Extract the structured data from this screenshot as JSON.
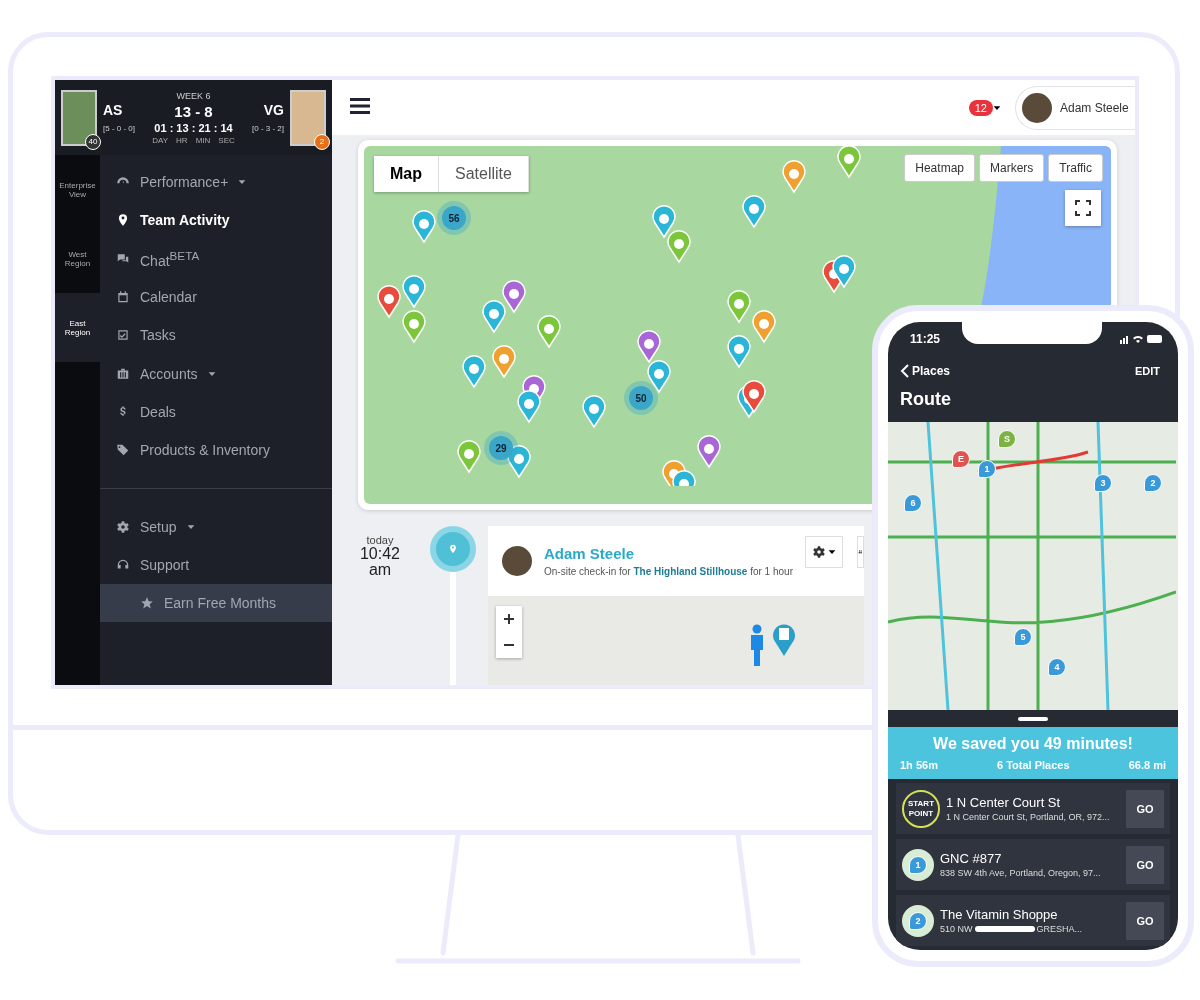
{
  "scoreboard": {
    "week": "WEEK 6",
    "home": {
      "initials": "AS",
      "record": "[5 - 0 - 0]",
      "badge": "40"
    },
    "away": {
      "initials": "VG",
      "record": "[0 - 3 - 2]",
      "badge": "2"
    },
    "score": "13 - 8",
    "countdown": "01 : 13 : 21 : 14",
    "units": [
      "DAY",
      "HR",
      "MIN",
      "SEC"
    ]
  },
  "regions": [
    {
      "label": "Enterprise View",
      "selected": false
    },
    {
      "label": "West Region",
      "selected": false
    },
    {
      "label": "East Region",
      "selected": true
    }
  ],
  "nav": [
    {
      "label": "Performance+",
      "kind": "menu",
      "selected": false
    },
    {
      "label": "Team Activity",
      "kind": "link",
      "selected": true
    },
    {
      "label": "Chat$^{BETA}$",
      "kind": "link",
      "selected": false
    },
    {
      "label": "Calendar",
      "kind": "link",
      "selected": false
    },
    {
      "label": "Tasks",
      "kind": "link",
      "selected": false
    },
    {
      "label": "Accounts",
      "kind": "menu",
      "selected": false
    },
    {
      "label": "Deals",
      "kind": "link",
      "selected": false
    },
    {
      "label": "Products & Inventory",
      "kind": "link",
      "selected": false
    }
  ],
  "nav_bottom": [
    {
      "label": "Setup",
      "kind": "menu",
      "selected": false
    },
    {
      "label": "Support",
      "kind": "link",
      "selected": false
    },
    {
      "label": "Earn Free Months",
      "kind": "promo",
      "selected": false
    }
  ],
  "topbar": {
    "notifications": "12",
    "user": "Adam Steele"
  },
  "map": {
    "tabs": [
      {
        "label": "Map",
        "selected": true
      },
      {
        "label": "Satellite",
        "selected": false
      }
    ],
    "layers": [
      "Heatmap",
      "Markers",
      "Traffic"
    ],
    "clusters": [
      {
        "count": "56"
      },
      {
        "count": "50"
      },
      {
        "count": "29"
      }
    ]
  },
  "activity": {
    "day": "today",
    "time": "10:42",
    "ampm": "am",
    "user": "Adam Steele",
    "text": "On-site check-in for **The Highland Stillhouse** for 1 hour"
  },
  "phone": {
    "time": "11:25",
    "back": "Places",
    "edit": "EDIT",
    "title": "Route",
    "pins": [
      "S",
      "E",
      "1",
      "3",
      "2",
      "6",
      "5",
      "4"
    ],
    "banner": {
      "title": "We saved you 49 minutes!",
      "stats": [
        "1h 56m",
        "6 Total Places",
        "66.8 mi"
      ]
    },
    "stops": [
      {
        "kind": "start",
        "badge": "START POINT",
        "name": "1 N Center Court St",
        "address": "1 N Center Court St, Portland, OR, 972...",
        "action": "GO"
      },
      {
        "kind": "stop",
        "badge": "1",
        "name": "GNC #877",
        "address": "838 SW 4th Ave, Portland, Oregon, 97...",
        "action": "GO"
      },
      {
        "kind": "stop",
        "badge": "2",
        "name": "The Vitamin Shoppe",
        "address": "510 NW",
        "address_tail": "GRESHA...",
        "action": "GO"
      }
    ]
  }
}
